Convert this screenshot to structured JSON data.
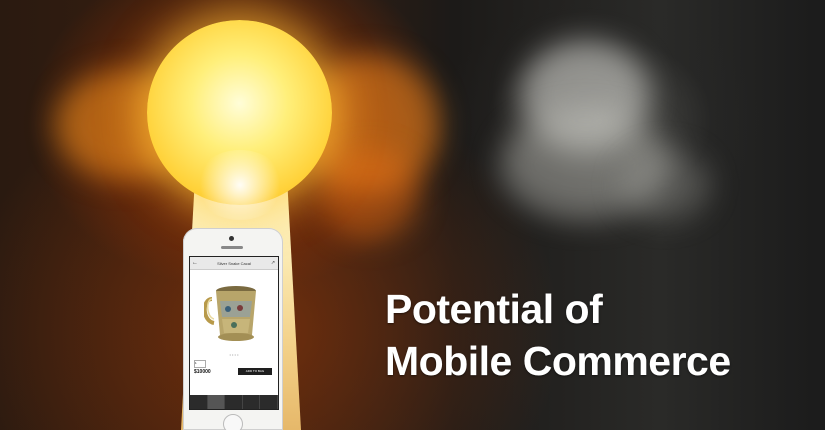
{
  "headline": {
    "line1": "Potential of",
    "line2": "Mobile Commerce"
  },
  "phone_screen": {
    "title": "Silver Snake Cacal",
    "price": "$10000",
    "add_button": "ADD TO BAG",
    "qty": "1"
  },
  "colors": {
    "keyhole_light": "#ffe36a",
    "headline_text": "#ffffff",
    "background_dark": "#1c1a18"
  }
}
